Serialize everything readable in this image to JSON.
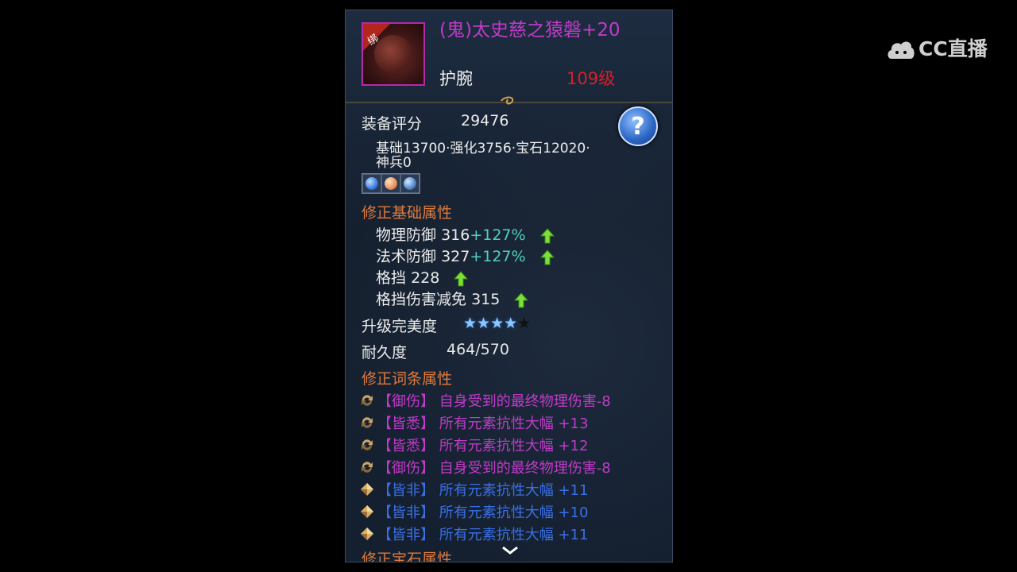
{
  "item": {
    "bound_tag": "绑",
    "name": "(鬼)太史慈之猿磐+20",
    "type": "护腕",
    "level": "109级"
  },
  "score": {
    "label": "装备评分",
    "value": "29476",
    "breakdown_line1": "基础13700·强化3756·宝石12020·",
    "breakdown_line2": "神兵0"
  },
  "help_button": "?",
  "gems": [
    {
      "icon": "blue-gem-icon",
      "color": "#3b7be0"
    },
    {
      "icon": "orange-gem-icon",
      "color": "#e7935a"
    },
    {
      "icon": "globe-gem-icon",
      "color": "#5a8fd0"
    }
  ],
  "base_section": {
    "title": "修正基础属性",
    "attrs": [
      {
        "name": "物理防御",
        "value": "316",
        "bonus": "+127%"
      },
      {
        "name": "法术防御",
        "value": "327",
        "bonus": "+127%"
      },
      {
        "name": "格挡",
        "value": "228",
        "bonus": ""
      },
      {
        "name": "格挡伤害减免",
        "value": "315",
        "bonus": ""
      }
    ]
  },
  "upgrade": {
    "label": "升级完美度",
    "stars_filled": 4,
    "stars_total": 5
  },
  "durability": {
    "label": "耐久度",
    "value": "464/570"
  },
  "affix_section": {
    "title": "修正词条属性",
    "affixes": [
      {
        "icon": "refresh-icon",
        "text": "【御伤】 自身受到的最终物理伤害-8"
      },
      {
        "icon": "refresh-icon",
        "text": "【皆悉】 所有元素抗性大幅 +13"
      },
      {
        "icon": "refresh-icon",
        "text": "【皆悉】 所有元素抗性大幅 +12"
      },
      {
        "icon": "refresh-icon",
        "text": "【御伤】 自身受到的最终物理伤害-8"
      },
      {
        "icon": "diamond-icon",
        "text": "【皆非】 所有元素抗性大幅 +11"
      },
      {
        "icon": "diamond-icon",
        "text": "【皆非】 所有元素抗性大幅 +10"
      },
      {
        "icon": "diamond-icon",
        "text": "【皆非】 所有元素抗性大幅 +11"
      }
    ]
  },
  "gem_section": {
    "title": "修正宝石属性"
  },
  "logo": {
    "text": "CC直播"
  }
}
